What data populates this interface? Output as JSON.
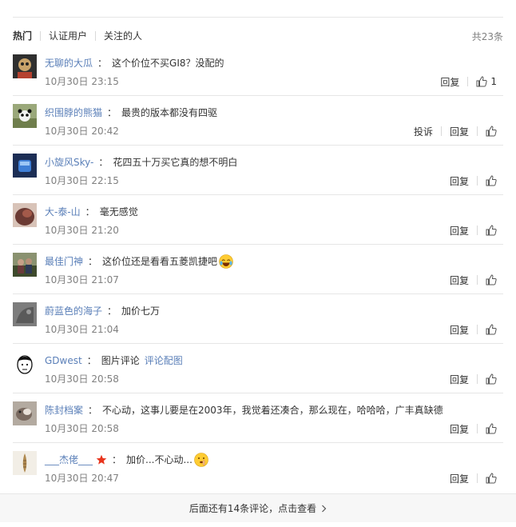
{
  "tabs": {
    "hot": "热门",
    "verified": "认证用户",
    "followed": "关注的人",
    "total": "共23条"
  },
  "comments": [
    {
      "user": "无聊的大瓜",
      "text": "这个价位不买GI8？没配的",
      "time": "10月30日 23:15",
      "reply": "回复",
      "likes": "1",
      "avatar_color": "#3a3a3a"
    },
    {
      "user": "织围脖的熊猫",
      "text": "最贵的版本都没有四驱",
      "time": "10月30日 20:42",
      "report": "投诉",
      "reply": "回复",
      "avatar_color": "#7a8f5a"
    },
    {
      "user": "小旋风Sky-",
      "text": "花四五十万买它真的想不明白",
      "time": "10月30日 22:15",
      "reply": "回复",
      "avatar_color": "#2b4f8f"
    },
    {
      "user": "大-泰-山",
      "text": "毫无感觉",
      "time": "10月30日 21:20",
      "reply": "回复",
      "avatar_color": "#6b3a33"
    },
    {
      "user": "最佳门神",
      "text": "这价位还是看看五菱凯捷吧",
      "time": "10月30日 21:07",
      "reply": "回复",
      "avatar_color": "#4d5a3a",
      "emoji": "laugh-cry-emoji"
    },
    {
      "user": "蔚蓝色的海子",
      "text": "加价七万",
      "time": "10月30日 21:04",
      "reply": "回复",
      "avatar_color": "#6e6e6e"
    },
    {
      "user": "GDwest",
      "text": "图片评论",
      "link": "评论配图",
      "time": "10月30日 20:58",
      "reply": "回复",
      "avatar_color": "#ffffff"
    },
    {
      "user": "陈封档案",
      "text": "不心动，这事儿要是在2003年，我觉着还凑合，那么现在，哈哈哈，广丰真缺德",
      "time": "10月30日 20:58",
      "reply": "回复",
      "avatar_color": "#8a7a70"
    },
    {
      "user": "___杰佬___",
      "text": "加价...不心动...",
      "time": "10月30日 20:47",
      "reply": "回复",
      "avatar_color": "#f2eee6",
      "emoji": "shush-emoji",
      "vip": true
    }
  ],
  "footer": {
    "more_text": "后面还有14条评论，点击查看"
  },
  "colors": {
    "username": "#5a7fb8",
    "divider": "#e6e6e6",
    "meta": "#808080"
  }
}
